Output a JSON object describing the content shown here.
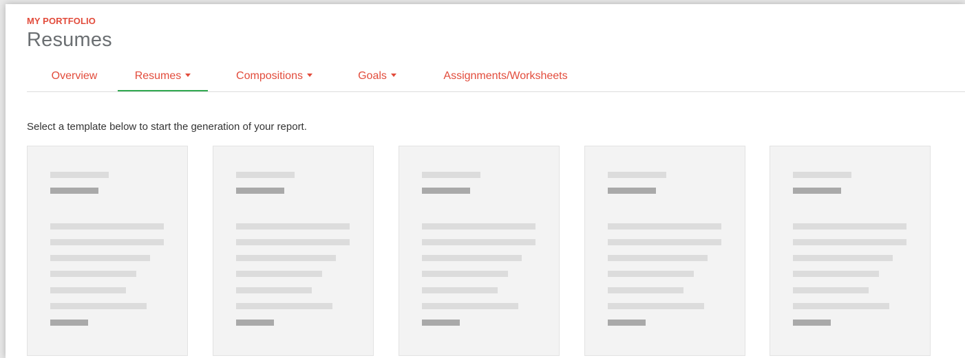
{
  "header": {
    "eyebrow": "MY PORTFOLIO",
    "title": "Resumes"
  },
  "tabs": [
    {
      "label": "Overview",
      "has_dropdown": false,
      "active": false
    },
    {
      "label": "Resumes",
      "has_dropdown": true,
      "active": true
    },
    {
      "label": "Compositions",
      "has_dropdown": true,
      "active": false
    },
    {
      "label": "Goals",
      "has_dropdown": true,
      "active": false
    },
    {
      "label": "Assignments/Worksheets",
      "has_dropdown": false,
      "active": false
    }
  ],
  "instruction": "Select a template below to start the generation of your report.",
  "templates_count": 5,
  "colors": {
    "accent": "#e24b3b",
    "active_tab_underline": "#2fa84f",
    "title_gray": "#6b6f72",
    "card_bg": "#f3f3f3",
    "placeholder_light": "#dcdcdc",
    "placeholder_dark": "#a9a9a9"
  }
}
